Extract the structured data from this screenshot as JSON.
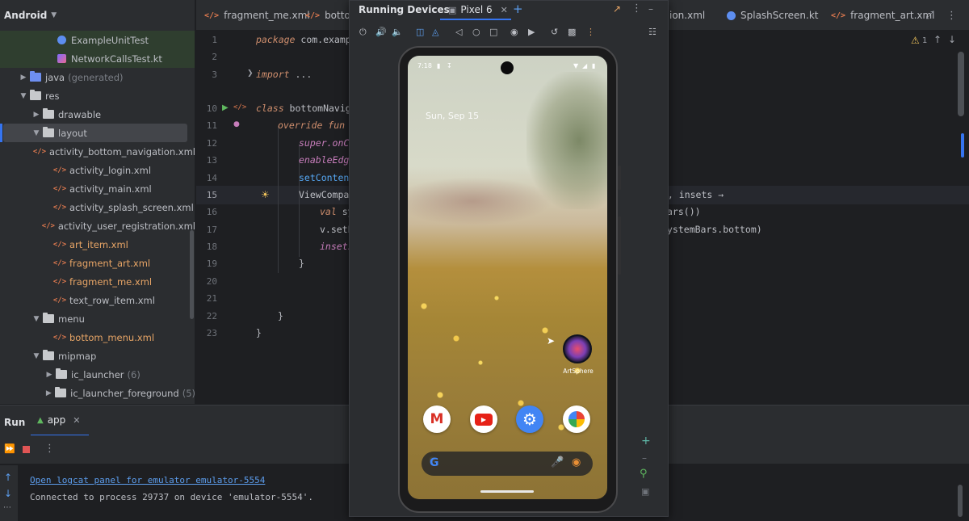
{
  "project": {
    "view_label": "Android",
    "items": [
      {
        "label": "ExampleUnitTest",
        "icon": "class-icon"
      },
      {
        "label": "NetworkCallsTest.kt",
        "icon": "kotlin-file-icon"
      },
      {
        "label": "java",
        "extra": "(generated)",
        "icon": "folder-icon"
      },
      {
        "label": "res",
        "icon": "folder-icon"
      },
      {
        "label": "drawable",
        "icon": "folder-icon"
      },
      {
        "label": "layout",
        "icon": "folder-icon"
      },
      {
        "label": "activity_bottom_navigation.xml",
        "icon": "xml-file-icon"
      },
      {
        "label": "activity_login.xml",
        "icon": "xml-file-icon"
      },
      {
        "label": "activity_main.xml",
        "icon": "xml-file-icon"
      },
      {
        "label": "activity_splash_screen.xml",
        "icon": "xml-file-icon"
      },
      {
        "label": "activity_user_registration.xml",
        "icon": "xml-file-icon"
      },
      {
        "label": "art_item.xml",
        "icon": "xml-file-icon"
      },
      {
        "label": "fragment_art.xml",
        "icon": "xml-file-icon"
      },
      {
        "label": "fragment_me.xml",
        "icon": "xml-file-icon"
      },
      {
        "label": "text_row_item.xml",
        "icon": "xml-file-icon"
      },
      {
        "label": "menu",
        "icon": "folder-icon"
      },
      {
        "label": "bottom_menu.xml",
        "icon": "xml-file-icon"
      },
      {
        "label": "mipmap",
        "icon": "folder-icon"
      },
      {
        "label": "ic_launcher",
        "extra": "(6)",
        "icon": "folder-icon"
      },
      {
        "label": "ic_launcher_foreground",
        "extra": "(5)",
        "icon": "folder-icon"
      }
    ]
  },
  "tabs": [
    {
      "label": "fragment_me.xml"
    },
    {
      "label": "botto"
    },
    {
      "label": "ion.xml"
    },
    {
      "label": "SplashScreen.kt"
    },
    {
      "label": "fragment_art.xml"
    }
  ],
  "editor": {
    "line_numbers": [
      "1",
      "2",
      "3",
      "10",
      "11",
      "12",
      "13",
      "14",
      "15",
      "16",
      "17",
      "18",
      "19",
      "20",
      "21",
      "22",
      "23"
    ],
    "warning_count": "1",
    "lines": {
      "l1_kw": "package",
      "l1_rest": " com.exampl",
      "l3_kw": "import",
      "l3_rest": " ...",
      "l10_kw": "class",
      "l10_rest": " bottomNaviga",
      "l11_kw": "override fun",
      "l11_rest": " o",
      "l12": "super.onCr",
      "l13": "enableEdge",
      "l14": "setContent",
      "l15": "ViewCompat",
      "l15_right": "v, insets →",
      "l16_kw": "val",
      "l16_rest": " sy",
      "l16_right": "ars())",
      "l17": "v.setP",
      "l17_right": "ystemBars.bottom)",
      "l18": "insets",
      "l19": "}",
      "l22": "}",
      "l23": "}"
    }
  },
  "devices": {
    "title": "Running Devices",
    "device_tab": "Pixel 6",
    "phone": {
      "time": "7:18",
      "date": "Sun, Sep 15",
      "app_label": "ArtSphere"
    }
  },
  "run": {
    "title": "Run",
    "config": "app",
    "console": [
      "Open logcat panel for emulator emulator-5554",
      "Connected to process 29737 on device 'emulator-5554'."
    ]
  }
}
